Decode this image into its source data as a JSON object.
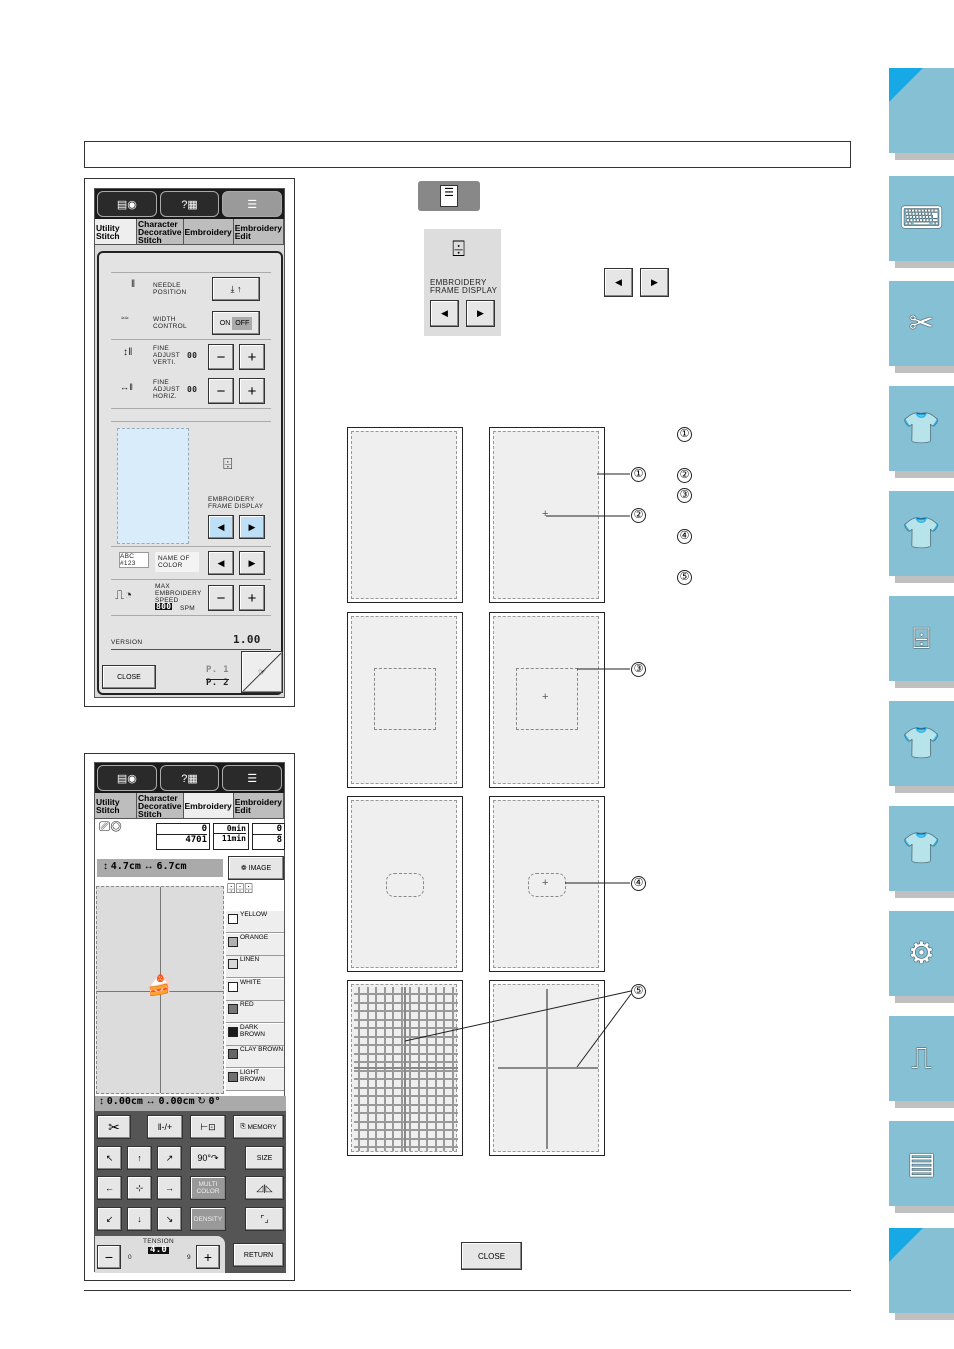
{
  "panel1": {
    "tabs": [
      "Utility Stitch",
      "Character Decorative Stitch",
      "Embroidery",
      "Embroidery Edit"
    ],
    "needle_position": "NEEDLE POSITION",
    "width_control": "WIDTH CONTROL",
    "on": "ON",
    "off": "OFF",
    "fine_vert": "FINE ADJUST VERTI.",
    "fine_horiz": "FINE ADJUST HORIZ.",
    "fine_value": "00",
    "frame_display": "EMBROIDERY FRAME DISPLAY",
    "name_of_color": "NAME OF COLOR",
    "abc_sample": "ABC #123",
    "max_speed": "MAX EMBROIDERY SPEED",
    "speed_value": "800",
    "speed_unit": "SPM",
    "version_label": "VERSION",
    "version_value": "1.00",
    "close": "CLOSE",
    "page_current": "P. 1",
    "page_total": "P. 2",
    "minus": "−",
    "plus": "+"
  },
  "panel2": {
    "tabs": [
      "Utility Stitch",
      "Character Decorative Stitch",
      "Embroidery",
      "Embroidery Edit"
    ],
    "stitch_current": "0",
    "stitch_total": "4701",
    "time_current": "0min",
    "time_total": "11min",
    "color_current": "0",
    "color_total": "8",
    "height": "4.7cm",
    "width": "6.7cm",
    "image": "IMAGE",
    "colors": [
      "YELLOW",
      "ORANGE",
      "LINEN",
      "WHITE",
      "RED",
      "DARK BROWN",
      "CLAY BROWN",
      "LIGHT BROWN"
    ],
    "color_swatches": [
      "#ffffff",
      "#b0b0b0",
      "#d8d8d8",
      "#ffffff",
      "#777777",
      "#1a1a1a",
      "#666666",
      "#707070"
    ],
    "offset_v": "0.00cm",
    "offset_h": "0.00cm",
    "angle": "0°",
    "needle_pm": "-/+",
    "memory": "MEMORY",
    "rotate": "90°",
    "size": "SIZE",
    "multi_color": "MULTI COLOR",
    "density": "DENSITY",
    "tension_label": "TENSION",
    "tension_value": "4.0",
    "tension_min": "0",
    "tension_max": "9",
    "return": "RETURN",
    "minus": "−",
    "plus": "+"
  },
  "center": {
    "frame_display": "EMBROIDERY FRAME DISPLAY",
    "close": "CLOSE",
    "callouts": [
      "①",
      "②",
      "③",
      "④",
      "⑤"
    ]
  },
  "side_tabs": [
    "corner",
    "sewing-machine-setup",
    "thread-bobbin-scissors",
    "shirt-utility",
    "shirt-abc",
    "embroidery-frame",
    "shirt-embroidery",
    "shirt-edit",
    "machine-maintenance",
    "machine-sewing",
    "documents",
    "corner"
  ],
  "colors": {
    "tab": "#86c0d4",
    "tab_corner": "#16a9e6",
    "screen_blue": "#d8ecfa"
  }
}
